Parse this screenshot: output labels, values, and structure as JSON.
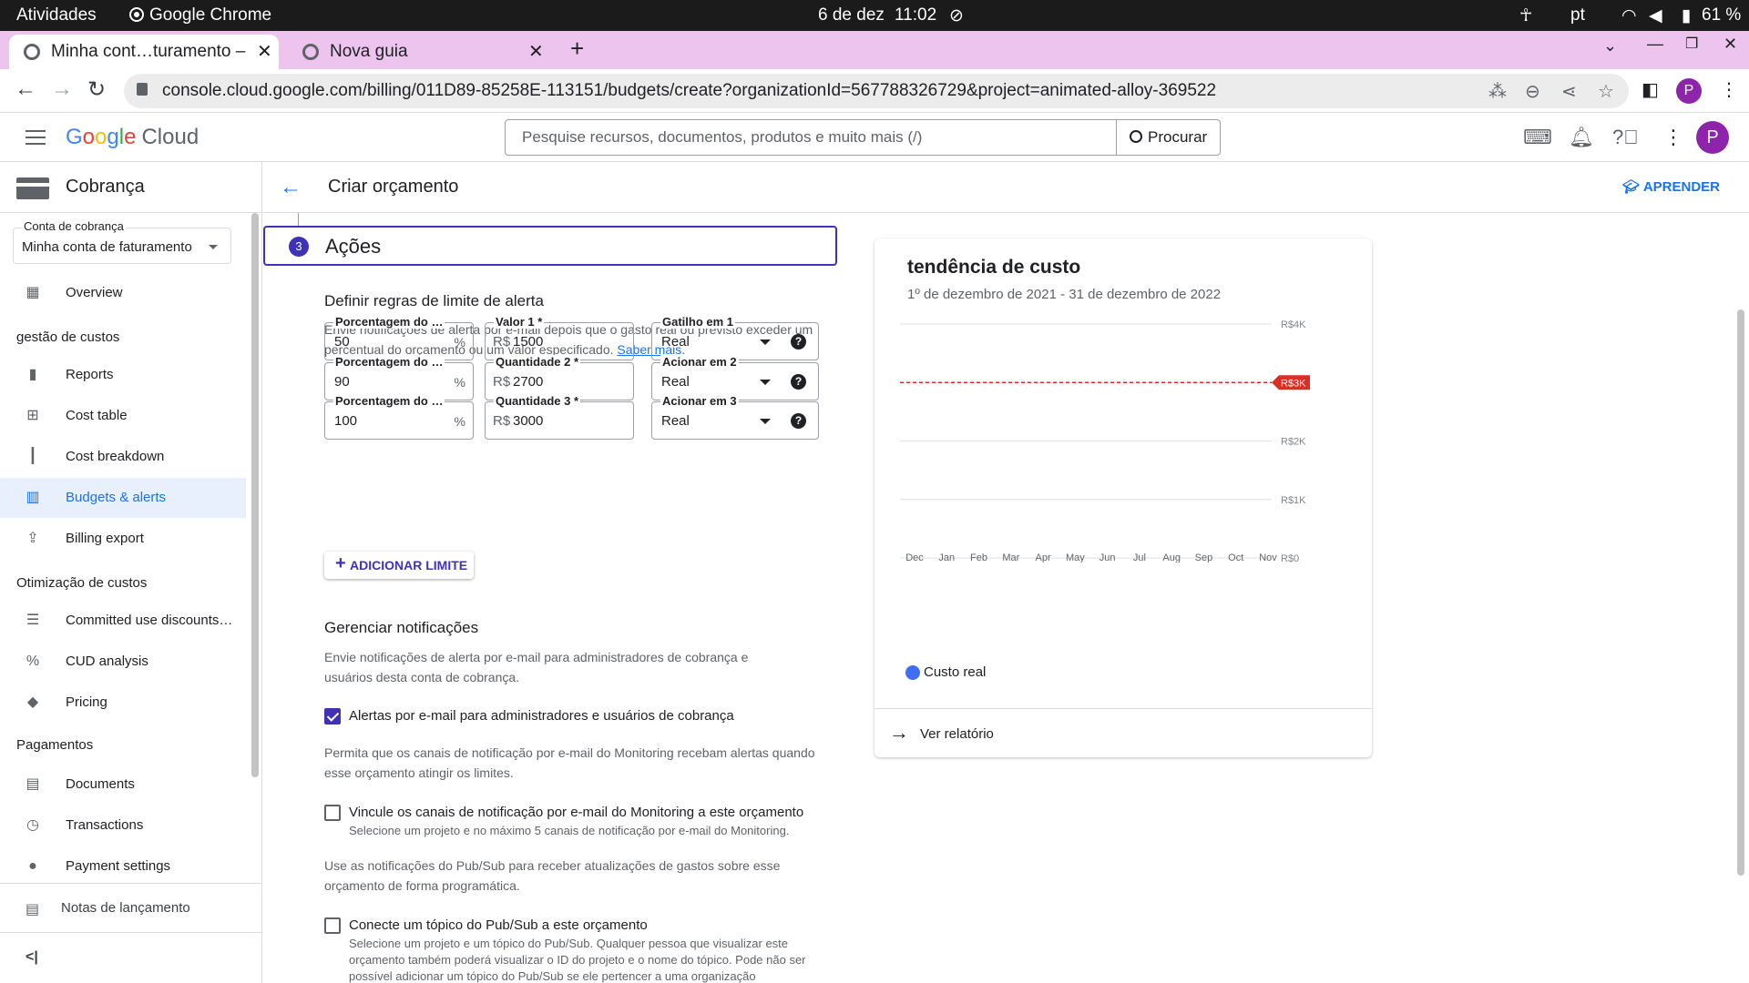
{
  "os": {
    "activities": "Atividades",
    "app": "Google Chrome",
    "date": "6 de dez",
    "time": "11:02",
    "lang": "pt",
    "battery": "61 %"
  },
  "browser": {
    "tabs": [
      {
        "title": "Minha cont…turamento –"
      },
      {
        "title": "Nova guia"
      }
    ],
    "url": "console.cloud.google.com/billing/011D89-85258E-113151/budgets/create?organizationId=567788326729&project=animated-alloy-369522",
    "profile_initial": "P"
  },
  "header": {
    "logo_google": "Google",
    "logo_cloud": "Cloud",
    "search_placeholder": "Pesquise recursos, documentos, produtos e muito mais (/)",
    "search_button": "Procurar",
    "avatar_initial": "P"
  },
  "sidebar": {
    "title": "Cobrança",
    "account_label": "Conta de cobrança",
    "account_value": "Minha conta de faturamento",
    "items": [
      {
        "label": "Overview",
        "icon": "dashboard-icon"
      },
      {
        "label": "Reports",
        "icon": "bar-chart-icon"
      },
      {
        "label": "Cost table",
        "icon": "table-icon"
      },
      {
        "label": "Cost breakdown",
        "icon": "waterfall-icon"
      },
      {
        "label": "Budgets & alerts",
        "icon": "budgets-icon"
      },
      {
        "label": "Billing export",
        "icon": "upload-icon"
      },
      {
        "label": "Committed use discounts…",
        "icon": "list-icon"
      },
      {
        "label": "CUD analysis",
        "icon": "percent-icon"
      },
      {
        "label": "Pricing",
        "icon": "tag-icon"
      },
      {
        "label": "Documents",
        "icon": "document-icon"
      },
      {
        "label": "Transactions",
        "icon": "clock-icon"
      },
      {
        "label": "Payment settings",
        "icon": "person-icon"
      }
    ],
    "sections": {
      "cost_management": "gestão de custos",
      "cost_optimization": "Otimização de custos",
      "payments": "Pagamentos"
    },
    "release_notes": "Notas de lançamento"
  },
  "page": {
    "title": "Criar orçamento",
    "learn": "APRENDER"
  },
  "actions": {
    "step_number": "3",
    "step_title": "Ações",
    "alert_rules_title": "Definir regras de limite de alerta",
    "alert_rules_desc": "Envie notificações de alerta por e-mail depois que o gasto real ou previsto exceder um percentual do orçamento ou um valor especificado.",
    "learn_more": "Saber mais.",
    "thresholds": [
      {
        "pct_label": "Porcentagem do …",
        "pct": "50",
        "amt_label": "Valor 1 *",
        "amt": "1500",
        "trig_label": "Gatilho em 1",
        "trig": "Real"
      },
      {
        "pct_label": "Porcentagem do …",
        "pct": "90",
        "amt_label": "Quantidade 2 *",
        "amt": "2700",
        "trig_label": "Acionar em 2",
        "trig": "Real"
      },
      {
        "pct_label": "Porcentagem do …",
        "pct": "100",
        "amt_label": "Quantidade 3 *",
        "amt": "3000",
        "trig_label": "Acionar em 3",
        "trig": "Real"
      }
    ],
    "pct_suffix": "%",
    "currency": "R$",
    "add_threshold": "ADICIONAR LIMITE",
    "notif_title": "Gerenciar notificações",
    "notif_desc": "Envie notificações de alerta por e-mail para administradores de cobrança e usuários desta conta de cobrança.",
    "cb_email_label": "Alertas por e-mail para administradores e usuários de cobrança",
    "cb_email_checked": true,
    "monitoring_desc": "Permita que os canais de notificação por e-mail do Monitoring recebam alertas quando esse orçamento atingir os limites.",
    "cb_monitoring_label": "Vincule os canais de notificação por e-mail do Monitoring a este orçamento",
    "cb_monitoring_sub": "Selecione um projeto e no máximo 5 canais de notificação por e-mail do Monitoring.",
    "pubsub_desc": "Use as notificações do Pub/Sub para receber atualizações de gastos sobre esse orçamento de forma programática.",
    "cb_pubsub_label": "Conecte um tópico do Pub/Sub a este orçamento",
    "cb_pubsub_sub": "Selecione um projeto e um tópico do Pub/Sub. Qualquer pessoa que visualizar este orçamento também poderá visualizar o ID do projeto e o nome do tópico. Pode não ser possível adicionar um tópico do Pub/Sub se ele pertencer a uma organização"
  },
  "trend": {
    "title": "tendência de custo",
    "range": "1º de dezembro de 2021 - 31 de dezembro de 2022",
    "legend": "Custo real",
    "view_report": "Ver relatório"
  },
  "chart_data": {
    "type": "line",
    "title": "tendência de custo",
    "subtitle": "1º de dezembro de 2021 - 31 de dezembro de 2022",
    "categories": [
      "Dec",
      "Jan",
      "Feb",
      "Mar",
      "Apr",
      "May",
      "Jun",
      "Jul",
      "Aug",
      "Sep",
      "Oct",
      "Nov"
    ],
    "series": [
      {
        "name": "Custo real",
        "values": [
          0,
          0,
          0,
          0,
          0,
          0,
          0,
          0,
          0,
          0,
          0,
          0
        ],
        "color": "#3f6ef0"
      }
    ],
    "y_ticks": [
      0,
      1000,
      2000,
      3000,
      4000
    ],
    "y_tick_labels": [
      "R$0",
      "R$1K",
      "R$2K",
      "R$3K",
      "R$4K"
    ],
    "ylim": [
      0,
      4000
    ],
    "budget_line": {
      "value": 3000,
      "label": "R$3K",
      "color": "#d93025"
    },
    "grid": true,
    "legend_position": "bottom-left"
  }
}
